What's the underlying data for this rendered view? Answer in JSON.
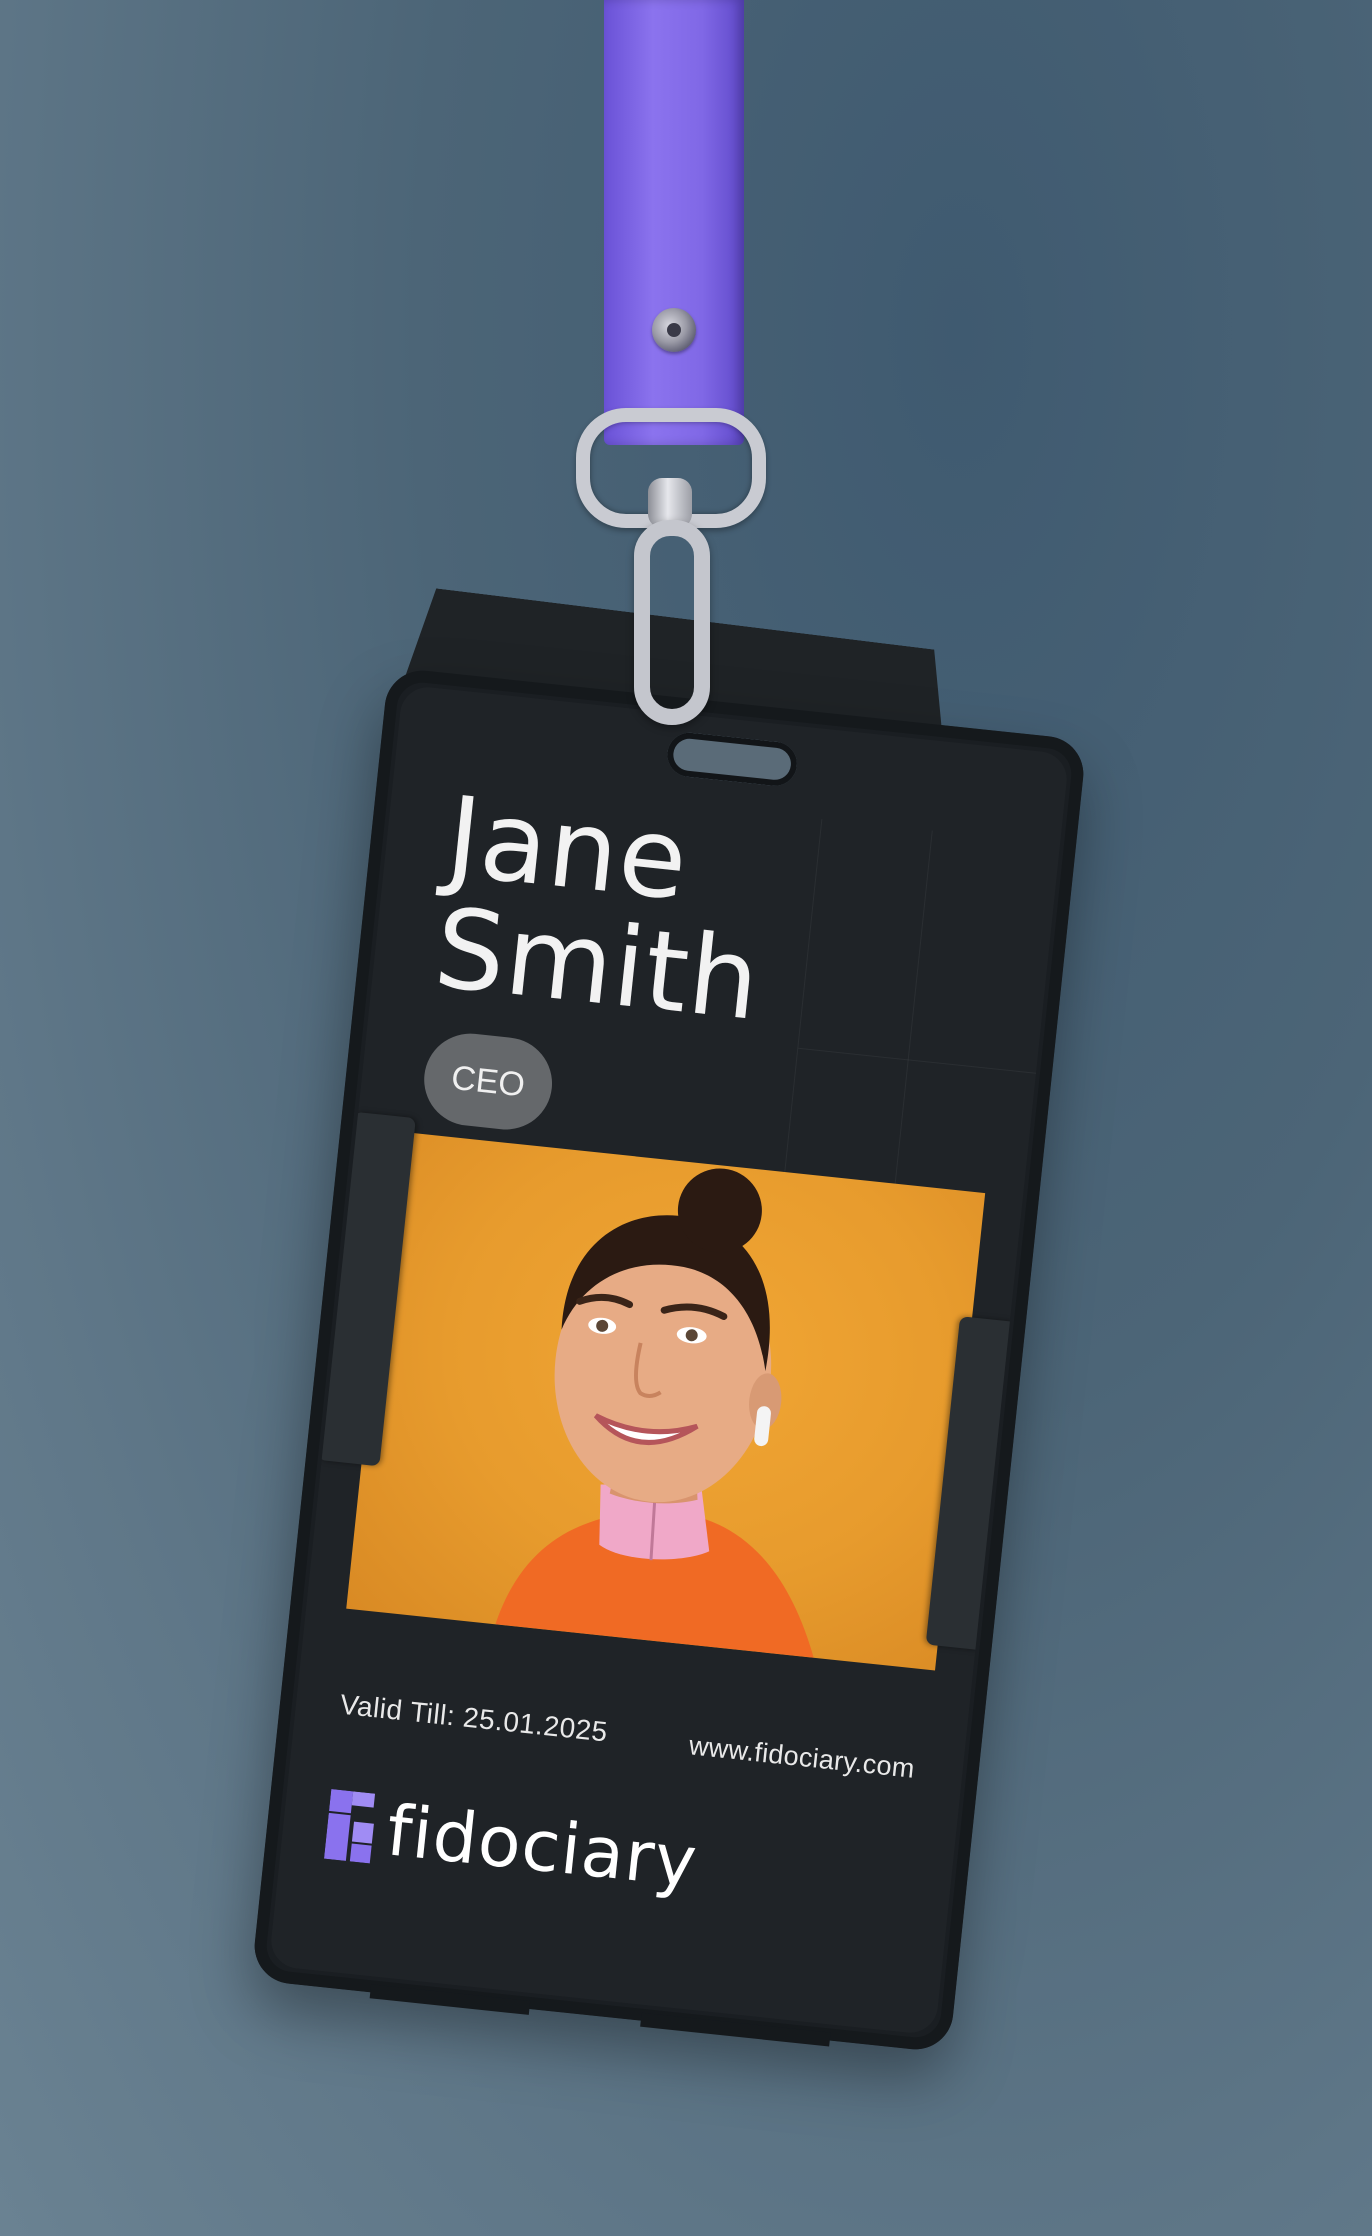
{
  "badge": {
    "first_name": "Jane",
    "last_name": "Smith",
    "role": "CEO",
    "valid_till": "Valid Till: 25.01.2025",
    "website": "www.fidociary.com",
    "brand": "fidociary"
  },
  "colors": {
    "lanyard": "#8068e6",
    "card": "#1f2327",
    "photo_background": "#e79b2d",
    "logo_mark": "#8a72ee",
    "role_pill": "#65686b"
  },
  "icons": {
    "logo": "fidociary-logo-icon"
  }
}
